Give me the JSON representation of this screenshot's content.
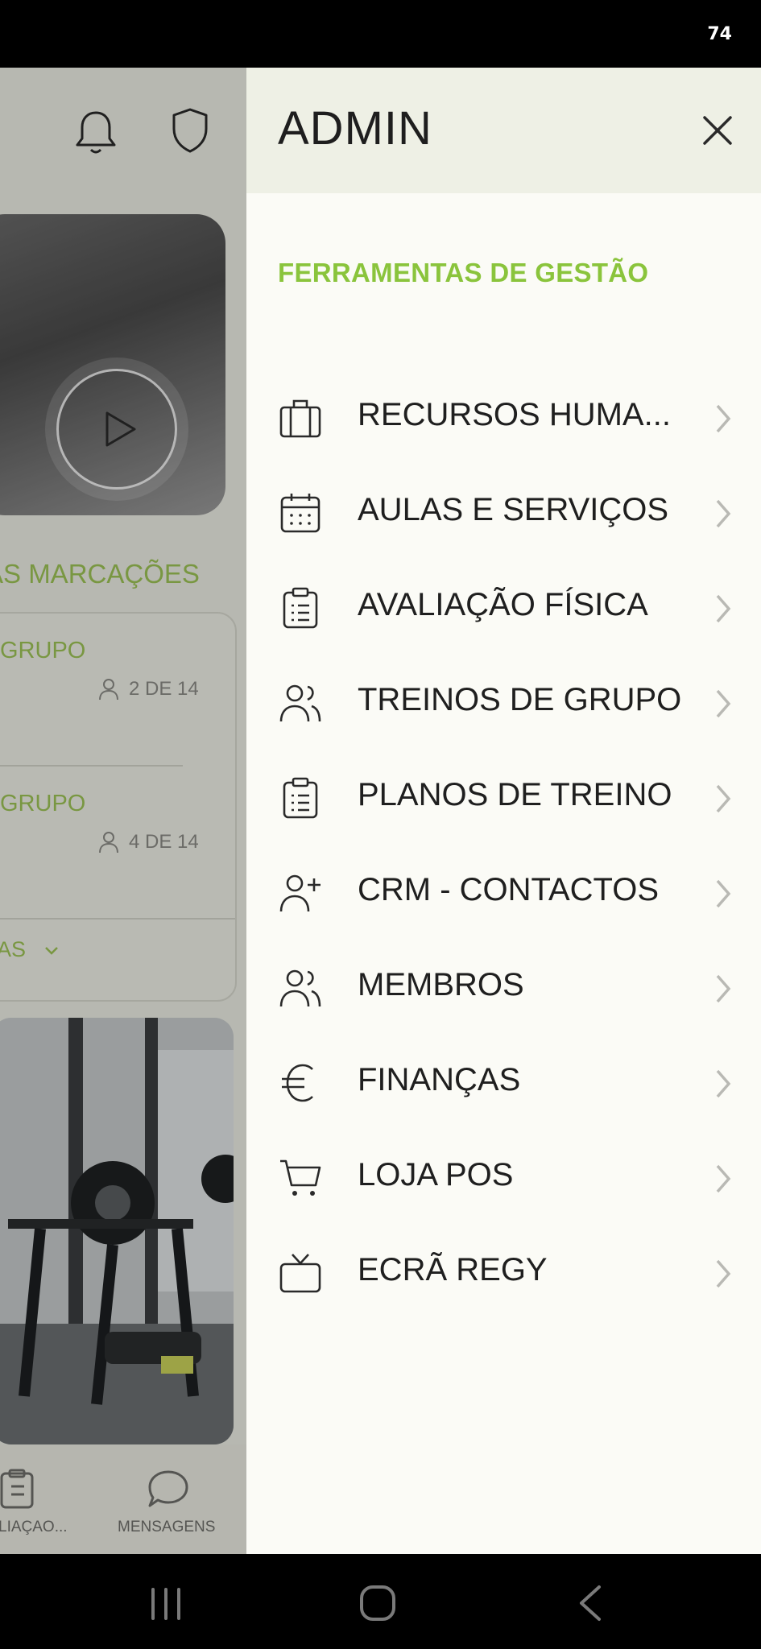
{
  "status": {
    "value": "74"
  },
  "background": {
    "section_label": "AS MARCAÇÕES",
    "bookings": [
      {
        "title": "GRUPO",
        "count": "2 DE 14"
      },
      {
        "title": "GRUPO",
        "count": "4 DE 14"
      }
    ],
    "more_label": "AS",
    "nav": [
      {
        "label": "LIAÇAO...",
        "icon": "clipboard-icon"
      },
      {
        "label": "MENSAGENS",
        "icon": "chat-icon"
      }
    ]
  },
  "drawer": {
    "title": "ADMIN",
    "group_label": "FERRAMENTAS DE GESTÃO",
    "items": [
      {
        "label": "RECURSOS HUMA...",
        "icon": "briefcase-icon"
      },
      {
        "label": "AULAS E SERVIÇOS",
        "icon": "calendar-icon"
      },
      {
        "label": "AVALIAÇÃO FÍSICA",
        "icon": "clipboard-icon"
      },
      {
        "label": "TREINOS DE GRUPO",
        "icon": "users-icon"
      },
      {
        "label": "PLANOS DE TREINO",
        "icon": "clipboard-icon"
      },
      {
        "label": "CRM - CONTACTOS",
        "icon": "user-plus-icon"
      },
      {
        "label": "MEMBROS",
        "icon": "users-icon"
      },
      {
        "label": "FINANÇAS",
        "icon": "euro-icon"
      },
      {
        "label": "LOJA POS",
        "icon": "cart-icon"
      },
      {
        "label": "ECRÃ REGY",
        "icon": "tv-icon"
      }
    ]
  },
  "colors": {
    "accent": "#8ac43c",
    "drawer_bg": "#fbfbf6",
    "header_bg": "#eef0e5"
  }
}
